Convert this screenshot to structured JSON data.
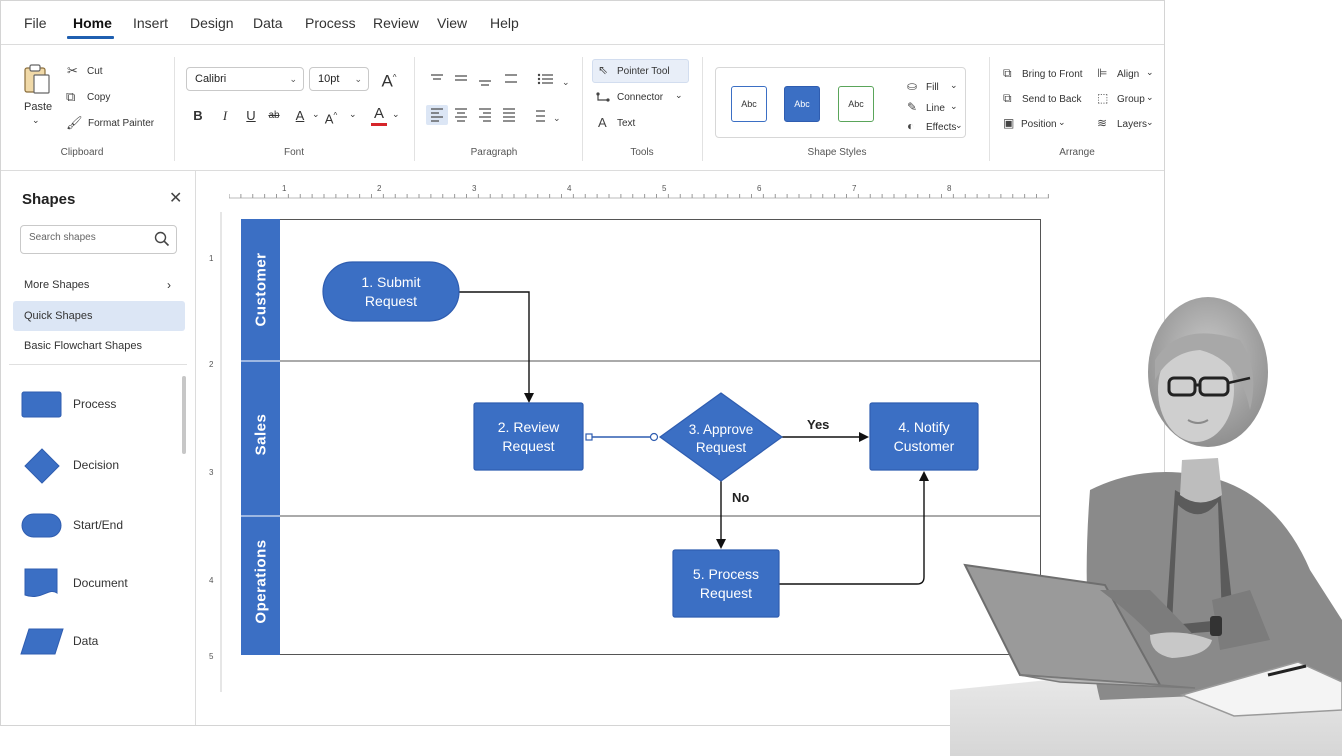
{
  "menu": {
    "items": [
      "File",
      "Home",
      "Insert",
      "Design",
      "Data",
      "Process",
      "Review",
      "View",
      "Help"
    ],
    "active": "Home"
  },
  "ribbon": {
    "clipboard": {
      "paste": "Paste",
      "cut": "Cut",
      "copy": "Copy",
      "format_painter": "Format Painter",
      "label": "Clipboard"
    },
    "font": {
      "family": "Calibri",
      "size": "10pt",
      "label": "Font"
    },
    "paragraph": {
      "label": "Paragraph"
    },
    "tools": {
      "pointer": "Pointer Tool",
      "connector": "Connector",
      "text": "Text",
      "label": "Tools"
    },
    "shape_styles": {
      "swatch": "Abc",
      "fill": "Fill",
      "line": "Line",
      "effects": "Effects",
      "label": "Shape Styles"
    },
    "arrange": {
      "bring_front": "Bring to Front",
      "send_back": "Send to Back",
      "position": "Position",
      "align": "Align",
      "group": "Group",
      "layers": "Layers",
      "label": "Arrange"
    }
  },
  "sidebar": {
    "title": "Shapes",
    "search_placeholder": "Search shapes",
    "links": [
      "More Shapes",
      "Quick Shapes",
      "Basic Flowchart Shapes"
    ],
    "active_link": "Quick Shapes",
    "shapes": [
      "Process",
      "Decision",
      "Start/End",
      "Document",
      "Data"
    ]
  },
  "rulers": {
    "horizontal": [
      "1",
      "2",
      "3",
      "4",
      "5",
      "6",
      "7",
      "8"
    ],
    "vertical": [
      "1",
      "2",
      "3",
      "4",
      "5"
    ]
  },
  "diagram": {
    "lanes": [
      "Customer",
      "Sales",
      "Operations"
    ],
    "nodes": [
      {
        "text": [
          "1. Submit",
          "Request"
        ],
        "shape": "start-end"
      },
      {
        "text": [
          "2. Review",
          "Request"
        ],
        "shape": "process"
      },
      {
        "text": [
          "3. Approve",
          "Request"
        ],
        "shape": "decision"
      },
      {
        "text": [
          "4. Notify",
          "Customer"
        ],
        "shape": "process"
      },
      {
        "text": [
          "5. Process",
          "Request"
        ],
        "shape": "process"
      }
    ],
    "edge_labels": {
      "yes": "Yes",
      "no": "No"
    }
  },
  "colors": {
    "accent": "#3b6fc4",
    "accent_dark": "#2f5db0",
    "lane_header": "#3b6fc4",
    "ribbon_active_tab": "#1f5fb0",
    "font_color_underline": "#d6252a"
  }
}
